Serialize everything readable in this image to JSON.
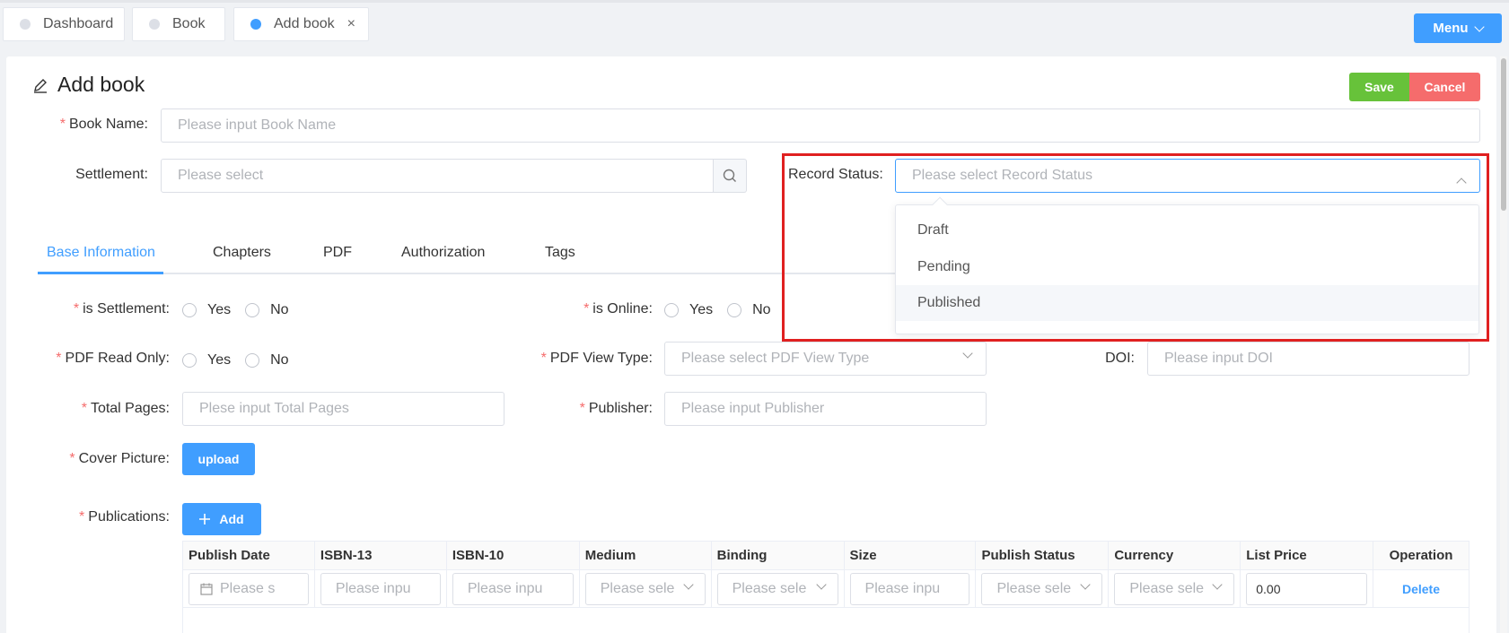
{
  "tabs": [
    {
      "label": "Dashboard",
      "active": false
    },
    {
      "label": "Book",
      "active": false
    },
    {
      "label": "Add book",
      "active": true,
      "close": "×"
    }
  ],
  "menu": {
    "label": "Menu"
  },
  "page": {
    "title": "Add book",
    "save_label": "Save",
    "cancel_label": "Cancel"
  },
  "form": {
    "book_name": {
      "label": "Book Name:",
      "placeholder": "Please input Book Name",
      "required": true
    },
    "settlement": {
      "label": "Settlement:",
      "placeholder": "Please select"
    },
    "record_status": {
      "label": "Record Status:",
      "placeholder": "Please select Record Status",
      "options": [
        "Draft",
        "Pending",
        "Published"
      ],
      "hovered_option": "Published"
    }
  },
  "subtabs": [
    "Base Information",
    "Chapters",
    "PDF",
    "Authorization",
    "Tags"
  ],
  "base": {
    "is_settlement": {
      "label": "is Settlement:",
      "yes": "Yes",
      "no": "No"
    },
    "is_online": {
      "label": "is Online:",
      "yes": "Yes",
      "no": "No"
    },
    "pdf_read_only": {
      "label": "PDF Read Only:",
      "yes": "Yes",
      "no": "No"
    },
    "pdf_view_type": {
      "label": "PDF View Type:",
      "placeholder": "Please select PDF View Type"
    },
    "doi": {
      "label": "DOI:",
      "placeholder": "Please input DOI"
    },
    "total_pages": {
      "label": "Total Pages:",
      "placeholder": "Plese input Total Pages"
    },
    "publisher": {
      "label": "Publisher:",
      "placeholder": "Please input Publisher"
    },
    "cover_picture": {
      "label": "Cover Picture:",
      "button": "upload"
    },
    "publications": {
      "label": "Publications:",
      "button": "Add"
    }
  },
  "table": {
    "headers": [
      "Publish Date",
      "ISBN-13",
      "ISBN-10",
      "Medium",
      "Binding",
      "Size",
      "Publish Status",
      "Currency",
      "List Price",
      "Operation"
    ],
    "row": {
      "publish_date": "Please s",
      "isbn13": "Please inpu",
      "isbn10": "Please inpu",
      "medium": "Please sele",
      "binding": "Please sele",
      "size": "Please inpu",
      "publish_status": "Please sele",
      "currency": "Please sele",
      "list_price": "0.00",
      "operation": "Delete"
    }
  },
  "colors": {
    "primary": "#409eff",
    "save": "#67c23a",
    "cancel": "#f56c6c",
    "highlight": "#e02020"
  }
}
